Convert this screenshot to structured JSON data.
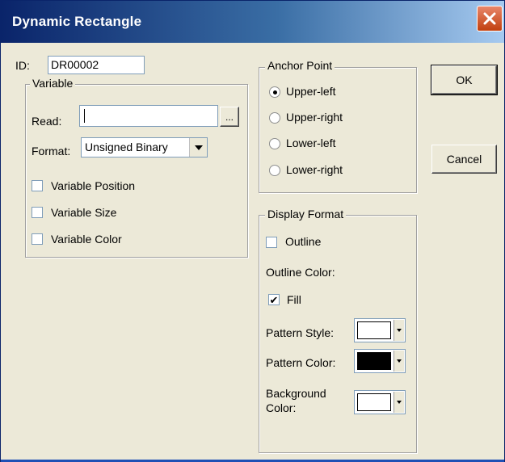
{
  "window": {
    "title": "Dynamic Rectangle"
  },
  "id_field": {
    "label": "ID:",
    "value": "DR00002"
  },
  "variable_group": {
    "legend": "Variable",
    "read_label": "Read:",
    "read_value": "",
    "browse_label": "...",
    "format_label": "Format:",
    "format_value": "Unsigned Binary",
    "checkboxes": [
      {
        "label": "Variable Position",
        "checked": false
      },
      {
        "label": "Variable Size",
        "checked": false
      },
      {
        "label": "Variable Color",
        "checked": false
      }
    ]
  },
  "anchor_group": {
    "legend": "Anchor Point",
    "options": [
      {
        "label": "Upper-left",
        "selected": true
      },
      {
        "label": "Upper-right",
        "selected": false
      },
      {
        "label": "Lower-left",
        "selected": false
      },
      {
        "label": "Lower-right",
        "selected": false
      }
    ]
  },
  "display_group": {
    "legend": "Display Format",
    "outline_label": "Outline",
    "outline_checked": false,
    "outline_color_label": "Outline Color:",
    "fill_label": "Fill",
    "fill_checked": true,
    "pattern_style_label": "Pattern Style:",
    "pattern_style_color": "#ffffff",
    "pattern_color_label": "Pattern Color:",
    "pattern_color_color": "#000000",
    "background_label_line1": "Background",
    "background_label_line2": "Color:",
    "background_color_color": "#ffffff"
  },
  "buttons": {
    "ok": "OK",
    "cancel": "Cancel"
  },
  "checkmark": "✔"
}
